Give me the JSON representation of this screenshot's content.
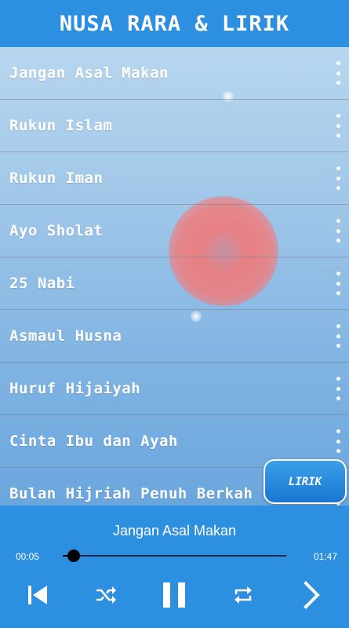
{
  "header": {
    "title": "NUSA RARA & LIRIK"
  },
  "songs": [
    {
      "title": "Jangan Asal Makan"
    },
    {
      "title": "Rukun Islam"
    },
    {
      "title": "Rukun Iman"
    },
    {
      "title": "Ayo Sholat"
    },
    {
      "title": "25 Nabi"
    },
    {
      "title": "Asmaul Husna"
    },
    {
      "title": "Huruf Hijaiyah"
    },
    {
      "title": "Cinta Ibu dan Ayah"
    },
    {
      "title": "Bulan Hijriah Penuh Berkah"
    }
  ],
  "lyrics_button": {
    "label": "LIRIK"
  },
  "player": {
    "now_playing": "Jangan Asal Makan",
    "elapsed": "00:05",
    "total": "01:47",
    "progress": 0.05
  },
  "icons": {
    "row_menu": "more-vertical-icon",
    "prev": "skip-previous-icon",
    "shuffle": "shuffle-icon",
    "pause": "pause-icon",
    "repeat": "repeat-icon",
    "next": "chevron-right-icon"
  },
  "colors": {
    "primary": "#2D8FE0",
    "text": "#FFFFFF"
  }
}
